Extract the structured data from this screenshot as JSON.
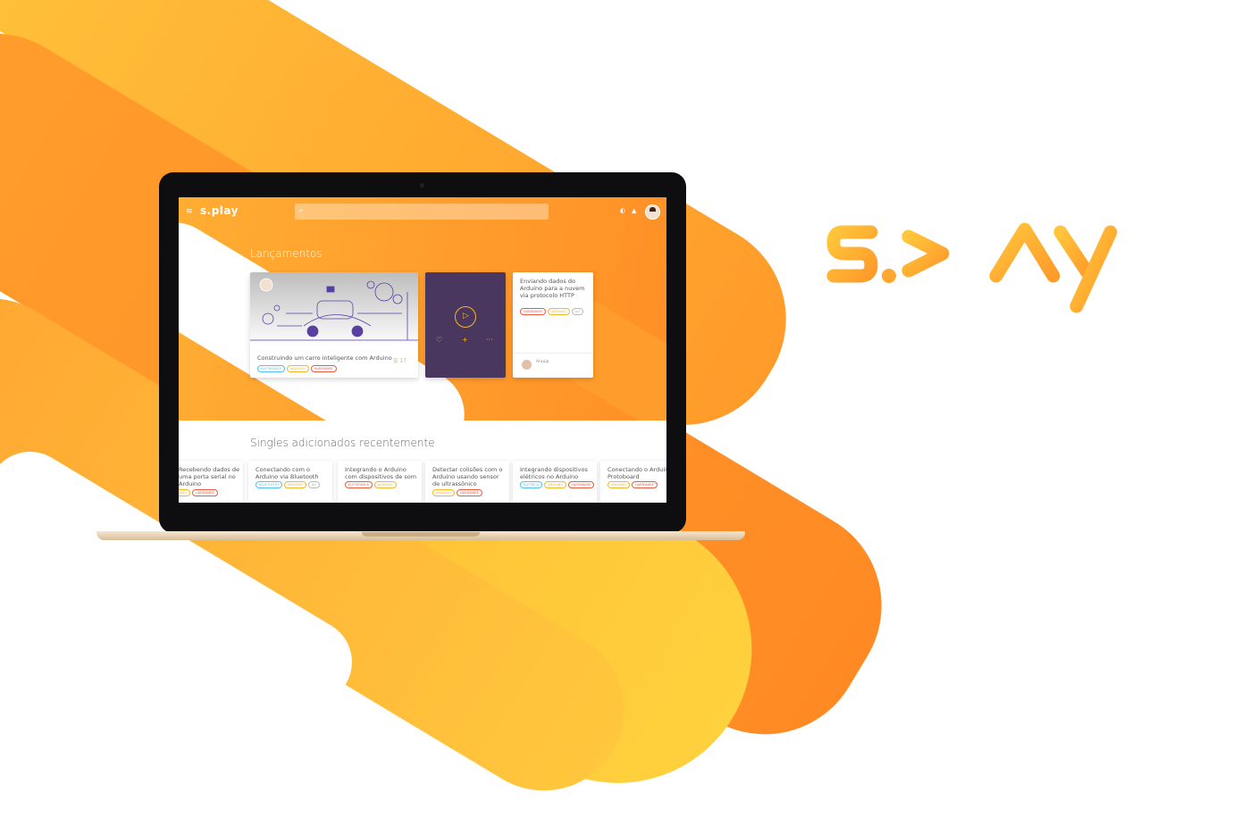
{
  "brand": {
    "name": "s.play",
    "primary": "#ff9a2b",
    "accent": "#f5b623",
    "purple": "#4a3760"
  },
  "app": {
    "menu_icon": "≡",
    "logo_text": "s.play",
    "search_placeholder": "",
    "avatar_alt": "user-avatar"
  },
  "launches": {
    "title": "Lançamentos",
    "featured": {
      "author": "",
      "title": "Construindo um carro inteligente com Arduino",
      "tags": [
        "ELETRÔNICA",
        "ARDUINO",
        "HARDWARE"
      ],
      "count": "17"
    },
    "video": {
      "actions": [
        "♡",
        "+",
        "···"
      ]
    },
    "article": {
      "title": "Enviando dados do Arduino para a nuvem via protocolo HTTP",
      "tags": [
        "HARDWARE",
        "ARDUINO",
        "IoT"
      ],
      "description": "",
      "author": "Araújo",
      "author_sub": ""
    }
  },
  "singles": {
    "title": "Singles adicionados recentemente",
    "items": [
      {
        "title": "Recebendo dados de uma porta serial no Arduino",
        "tags": [
          "ARDUINO",
          "HARDWARE"
        ]
      },
      {
        "title": "Conectando com o Arduino via Bluetooth",
        "tags": [
          "BLUETOOTH",
          "ARDUINO",
          "IoT"
        ]
      },
      {
        "title": "Integrando o Arduino com dispositivos de som",
        "tags": [
          "ELETRÔNICA",
          "ARDUINO"
        ]
      },
      {
        "title": "Detectar colisões com o Arduino usando sensor de ultrassônico",
        "tags": [
          "ARDUINO",
          "HARDWARE"
        ]
      },
      {
        "title": "Integrando dispositivos elétricos no Arduino",
        "tags": [
          "ELÉTRICA",
          "ARDUINO",
          "HARDWARE"
        ]
      },
      {
        "title": "Conectando o Arduino na Protoboard",
        "tags": [
          "ARDUINO",
          "HARDWARE"
        ]
      }
    ]
  }
}
